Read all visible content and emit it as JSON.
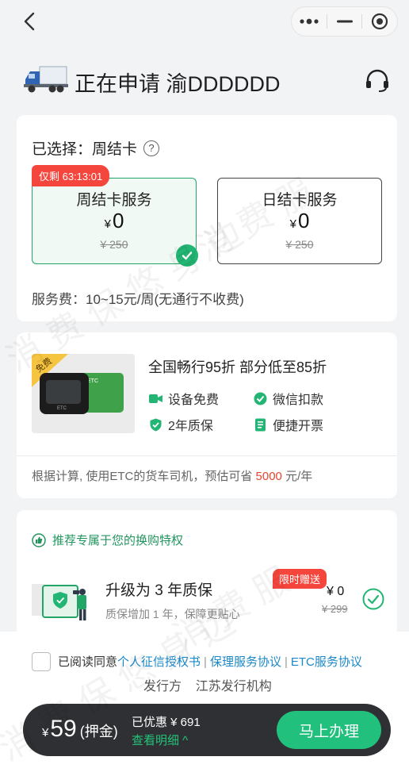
{
  "header": {
    "title": "正在申请 渝DDDDDD"
  },
  "service_select": {
    "selected_label": "已选择：周结卡",
    "help_icon": "?",
    "timer_badge": "仅剩 63:13:01",
    "options": [
      {
        "name": "周结卡服务",
        "currency": "¥",
        "price": "0",
        "original": "¥ 250",
        "selected": true
      },
      {
        "name": "日结卡服务",
        "currency": "¥",
        "price": "0",
        "original": "¥ 250",
        "selected": false
      }
    ],
    "fee_text": "服务费：10~15元/周(无通行不收费)"
  },
  "product": {
    "free_tag": "免费",
    "headline": "全国畅行95折 部分低至85折",
    "features": [
      "设备免费",
      "微信扣款",
      "2年质保",
      "便捷开票"
    ],
    "estimate_prefix": "根据计算, 使用ETC的货车司机，预估可省",
    "estimate_amount": "5000",
    "estimate_suffix": "元/年"
  },
  "upgrade": {
    "recommend": "推荐专属于您的换购特权",
    "title": "升级为 3 年质保",
    "subtitle": "质保增加 1 年，保障更贴心",
    "badge": "限时赠送",
    "price": "¥ 0",
    "original": "¥ 299"
  },
  "agreement": {
    "prefix": "已阅读同意",
    "links": [
      "个人征信授权书",
      "保理服务协议",
      "ETC服务协议"
    ],
    "issuer": "发行方    江苏发行机构"
  },
  "paybar": {
    "currency": "¥",
    "amount": "59",
    "amount_label": "(押金)",
    "discount": "已优惠 ¥ 691",
    "detail": "查看明细 ^",
    "submit": "马上办理"
  },
  "colors": {
    "accent_green": "#22c07d",
    "alert_red": "#f5463e",
    "link_blue": "#1a88c9"
  },
  "icons": [
    "back-arrow-icon",
    "more-icon",
    "minimize-icon",
    "close-target-icon",
    "truck-icon",
    "headset-icon",
    "help-icon",
    "check-icon",
    "video-icon",
    "wechat-pay-icon",
    "shield-check-icon",
    "invoice-icon",
    "thumb-up-icon"
  ]
}
